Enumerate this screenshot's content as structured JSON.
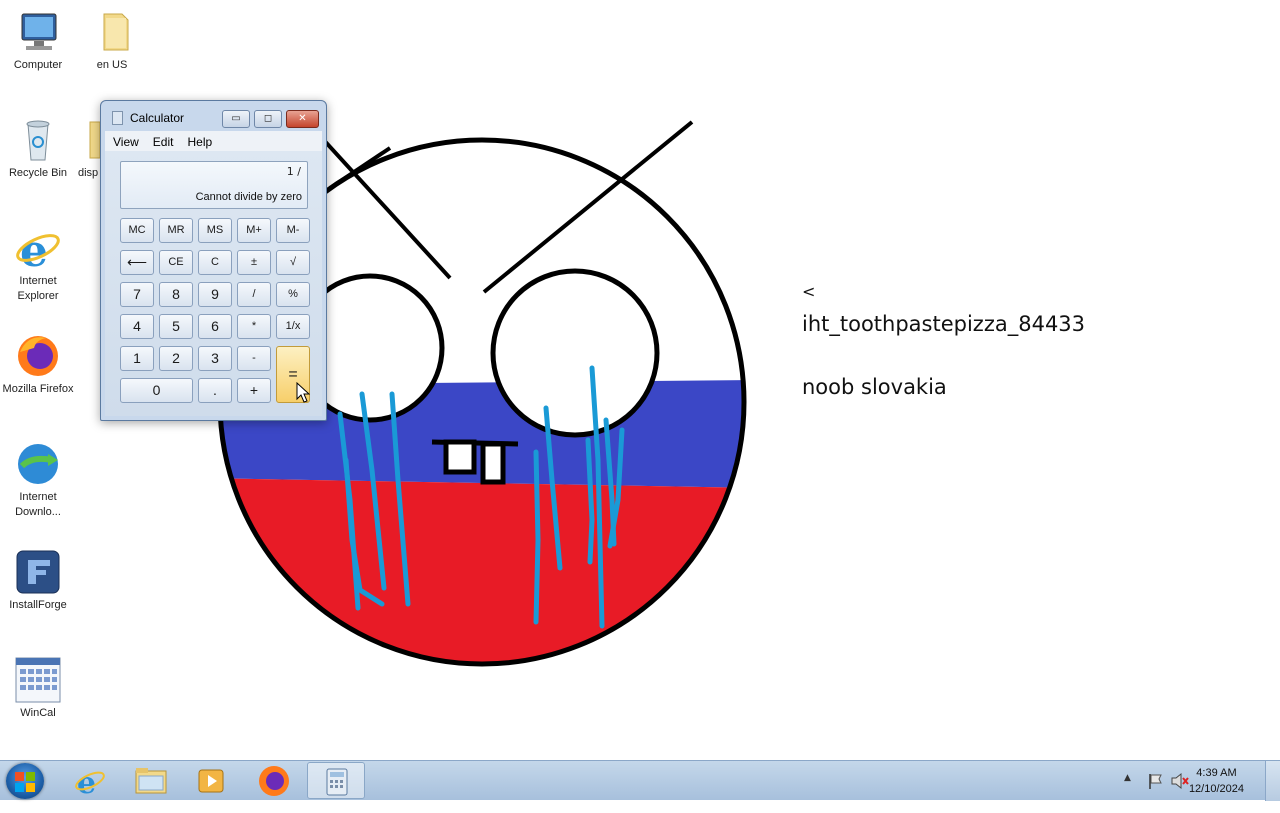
{
  "desktop": {
    "icons": [
      {
        "label": "Computer",
        "icon": "computer-icon"
      },
      {
        "label": "en US",
        "icon": "folder-icon"
      },
      {
        "label": "Recycle Bin",
        "icon": "recycle-bin-icon"
      },
      {
        "label": "disp",
        "icon": "folder-icon"
      },
      {
        "label": "Internet Explorer",
        "icon": "internet-explorer-icon"
      },
      {
        "label": "Mozilla Firefox",
        "icon": "firefox-icon"
      },
      {
        "label": "Internet Downlo...",
        "icon": "internet-download-manager-icon"
      },
      {
        "label": "InstallForge",
        "icon": "installforge-icon"
      },
      {
        "label": "WinCal",
        "icon": "wincal-icon"
      }
    ],
    "wallpaper_text": {
      "line1": "<",
      "line2": "iht_toothpastepizza_84433",
      "line3": "noob slovakia"
    },
    "wallpaper_colors": {
      "white": "#ffffff",
      "blue": "#3b47c6",
      "red": "#e81b26",
      "tears": "#1a9ad6"
    }
  },
  "calculator": {
    "title": "Calculator",
    "menu": [
      "View",
      "Edit",
      "Help"
    ],
    "display": {
      "expression": "1 /",
      "value": "Cannot divide by zero"
    },
    "buttons": {
      "mc": "MC",
      "mr": "MR",
      "ms": "MS",
      "mplus": "M+",
      "mminus": "M-",
      "back": "⟵",
      "ce": "CE",
      "c": "C",
      "plusminus": "±",
      "sqrt": "√",
      "n7": "7",
      "n8": "8",
      "n9": "9",
      "div": "/",
      "pct": "%",
      "n4": "4",
      "n5": "5",
      "n6": "6",
      "mul": "*",
      "recip": "1/x",
      "n1": "1",
      "n2": "2",
      "n3": "3",
      "minus": "-",
      "equals": "=",
      "n0": "0",
      "dot": ".",
      "plus": "+"
    },
    "window_buttons": {
      "minimize": "▭",
      "restore": "◻",
      "close": "✕"
    }
  },
  "taskbar": {
    "pinned": [
      "internet-explorer-icon",
      "file-explorer-icon",
      "media-player-icon",
      "firefox-icon",
      "calculator-icon"
    ],
    "tray": {
      "time": "4:39 AM",
      "date": "12/10/2024",
      "expand": "▲"
    }
  }
}
